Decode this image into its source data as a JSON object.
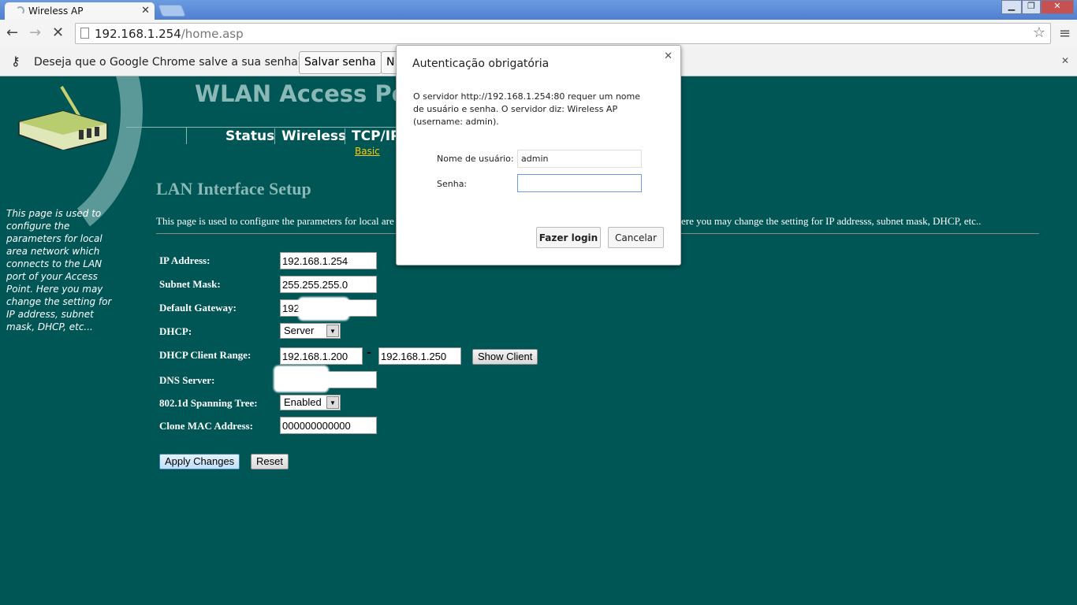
{
  "browser": {
    "tab_title": "Wireless AP",
    "url_host": "192.168.1.254",
    "url_path": "/home.asp",
    "infobar": {
      "message": "Deseja que o Google Chrome salve a sua senha?",
      "save_label": "Salvar senha",
      "never_label": "N"
    }
  },
  "header": {
    "title": "WLAN Access Poi",
    "tabs": [
      "Status",
      "Wireless",
      "TCP/IP"
    ],
    "subtab": "Basic"
  },
  "sidebar": {
    "help": "This page is used to configure the parameters for local area network which connects to the LAN port of your Access Point. Here you may change the setting for IP address, subnet mask, DHCP, etc..."
  },
  "main": {
    "heading": "LAN Interface Setup",
    "desc_left": "This page is used to configure the parameters for local are",
    "desc_right": "ere you may change the setting for IP addresss, subnet mask, DHCP, etc..",
    "fields": {
      "ip_label": "IP Address:",
      "ip": "192.168.1.254",
      "mask_label": "Subnet Mask:",
      "mask": "255.255.255.0",
      "gw_label": "Default Gateway:",
      "gw": "192.",
      "dhcp_label": "DHCP:",
      "dhcp": "Server",
      "range_label": "DHCP Client Range:",
      "range_start": "192.168.1.200",
      "range_sep": "-",
      "range_end": "192.168.1.250",
      "show_client": "Show Client",
      "dns_label": "DNS Server:",
      "dns": "",
      "stp_label": "802.1d Spanning Tree:",
      "stp": "Enabled",
      "mac_label": "Clone MAC Address:",
      "mac": "000000000000"
    },
    "apply": "Apply Changes",
    "reset": "Reset"
  },
  "dialog": {
    "title": "Autenticação obrigatória",
    "message": "O servidor http://192.168.1.254:80 requer um nome de usuário e senha. O servidor diz: Wireless AP (username: admin).",
    "user_label": "Nome de usuário:",
    "user": "admin",
    "pass_label": "Senha:",
    "pass": "",
    "login": "Fazer login",
    "cancel": "Cancelar"
  }
}
